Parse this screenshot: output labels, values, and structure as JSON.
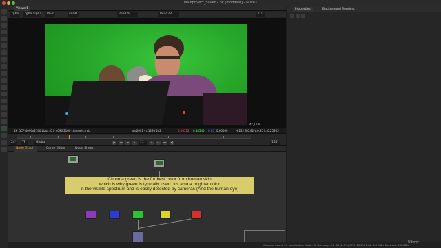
{
  "window": {
    "title": "Mainproject_Saved2.nk [modified] - NukeX"
  },
  "viewer": {
    "tab_label": "Viewer1",
    "channels": "rgba",
    "layer": "rgba.alpha",
    "colorspace": "RGB",
    "lut": "sRGB",
    "input_a": "Read28",
    "input_b": "Read28",
    "zoom_value": "1:1",
    "frame_label_left": "4K_DCP",
    "frame_label_right": "4K_DCP",
    "info_format": "4K_DCP 4096x2160  bbox: 0 0 4096 2160 channels: rgb",
    "info_xy": "x=2001 y=1293 2x2",
    "info_r": "0.26512",
    "info_g": "0.34540",
    "info_b": "0.05",
    "info_a": "0.00000",
    "info_hsv": "H:132 S:0.92 V:0.35  L: 0.25955",
    "fps": "24*",
    "tf": "TF",
    "mode": "Global",
    "frame": "11",
    "end_frame": "135"
  },
  "graph": {
    "tabs": [
      "Node Graph",
      "Curve Editor",
      "Dope Sheet"
    ],
    "callout_lines": [
      "Chroma green is the furthest color from human skin",
      "which is why green is typically used.  It's also a brighter color",
      "in the visible spectrum and is easily detected by cameras (And the human eye)"
    ],
    "nodes": [
      {
        "name": "read-node-1",
        "color": "#9e9e9e"
      },
      {
        "name": "read-node-2",
        "color": "#9e9e9e"
      },
      {
        "name": "purple-node",
        "color": "#8a3bb8"
      },
      {
        "name": "blue-node",
        "color": "#2a3bd6"
      },
      {
        "name": "green-node",
        "color": "#2bc42e"
      },
      {
        "name": "yellow-node",
        "color": "#d9d42a"
      },
      {
        "name": "red-node",
        "color": "#d6302a"
      },
      {
        "name": "merge-node",
        "color": "#6a6aa0"
      }
    ]
  },
  "properties": {
    "tabs": [
      "Properties",
      "Background Renders"
    ]
  },
  "status": {
    "text": "Channel Count: 20  Localization Mode: On  Memory: 4.2 GB (6.6%)  CPU: 13.2%  Disk: 0.0 MB/s  Network: 0.0 MB/s"
  },
  "watermark": {
    "text": "Udemy"
  },
  "colors": {
    "accent": "#e79a3a",
    "greenscreen": "#23a126",
    "callout_bg": "#d8cc6c"
  }
}
